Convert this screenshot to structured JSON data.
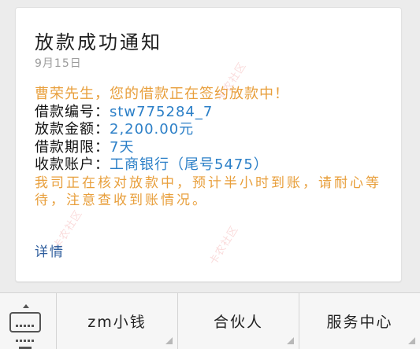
{
  "message": {
    "title": "放款成功通知",
    "date": "9月15日",
    "greeting": "曹荣先生，您的借款正在签约放款中！",
    "fields": [
      {
        "label": "借款编号：",
        "value": "stw775284_7"
      },
      {
        "label": "放款金额：",
        "value": "2,200.00元"
      },
      {
        "label": "借款期限：",
        "value": "7天"
      },
      {
        "label": "收款账户：",
        "value": "工商银行（尾号5475）"
      }
    ],
    "note": "我司正在核对放款中，预计半小时到账，请耐心等待，注意查收到账情况。",
    "detail_link": "详情"
  },
  "watermark": {
    "text": "卡农社区"
  },
  "menu": {
    "keyboard_icon": "keyboard-icon",
    "items": [
      {
        "label": "zm小钱"
      },
      {
        "label": "合伙人"
      },
      {
        "label": "服务中心"
      }
    ]
  }
}
